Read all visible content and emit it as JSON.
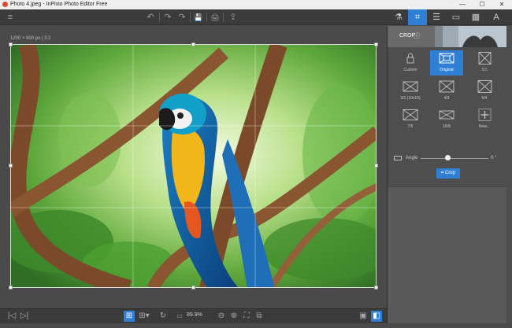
{
  "titlebar": {
    "title": "Photo 4.jpeg - InPixio Photo Editor Free",
    "minimize": "—",
    "maximize": "☐",
    "close": "✕"
  },
  "toolbar": {
    "menu_icon": "≡",
    "undo": "↶",
    "redo": "↷",
    "redo2": "↷",
    "save": "💾",
    "print": "🖨",
    "share": "⇪"
  },
  "tabs": {
    "effects": "⚗",
    "crop": "⌗",
    "adjust": "☰",
    "frame": "▭",
    "texture": "▦",
    "text": "A"
  },
  "canvas": {
    "info": "1200 × 800 px | 3:2"
  },
  "panel": {
    "title": "CROP",
    "info": "ⓘ",
    "tiles": [
      {
        "label": "Custom"
      },
      {
        "label": "Original"
      },
      {
        "label": "1/1"
      },
      {
        "label": "3/2 (10x15)"
      },
      {
        "label": "4/3"
      },
      {
        "label": "5/4"
      },
      {
        "label": "7/5"
      },
      {
        "label": "16/9"
      },
      {
        "label": "New..."
      }
    ],
    "angle_label": "Angle",
    "angle_value": "0 °",
    "crop_button": "Crop",
    "angle_value_num": 0
  },
  "bottombar": {
    "prev": "|◁",
    "next": "▷|",
    "fit": "⊞",
    "grid": "⊞▾",
    "rotate": "↻",
    "zoom": "89.9%",
    "zoom_out": "⊖",
    "zoom_in": "⊕",
    "fit2": "⛶",
    "compare": "⧉",
    "view1": "▣",
    "view2": "◧"
  },
  "colors": {
    "accent": "#2f7fd4",
    "panel_bg": "#595959",
    "canvas_bg": "#4a4a4a"
  }
}
